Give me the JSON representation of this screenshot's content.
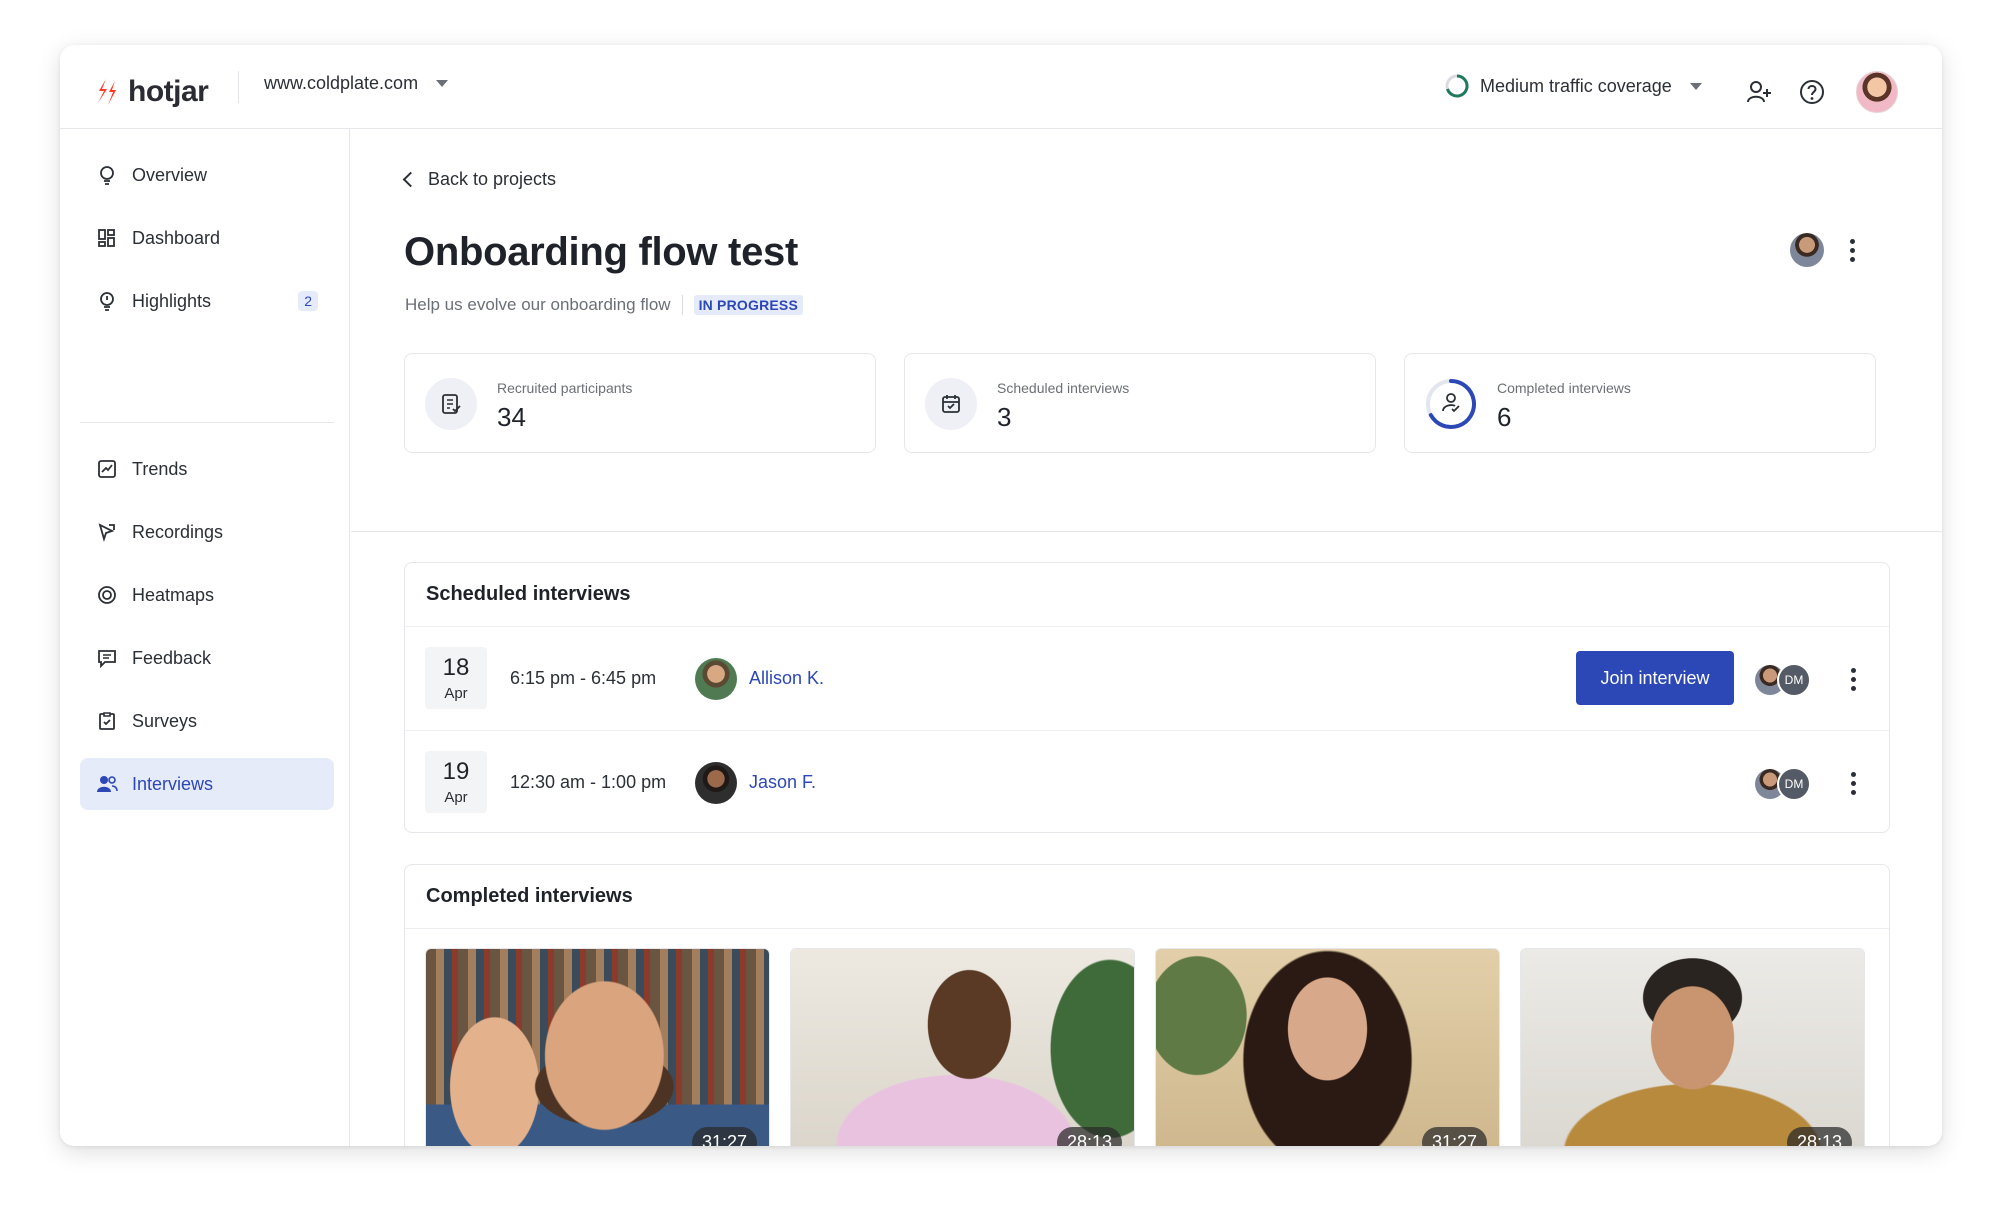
{
  "header": {
    "logo_text": "hotjar",
    "site": "www.coldplate.com",
    "traffic_label": "Medium traffic coverage",
    "brand_color": "#fd3a25",
    "accent_color": "#2c47b6"
  },
  "sidebar": {
    "items": [
      {
        "label": "Overview",
        "icon": "lightbulb-icon"
      },
      {
        "label": "Dashboard",
        "icon": "dashboard-icon"
      },
      {
        "label": "Highlights",
        "icon": "highlight-icon",
        "badge": "2"
      },
      {
        "label": "Trends",
        "icon": "trends-icon"
      },
      {
        "label": "Recordings",
        "icon": "recordings-icon"
      },
      {
        "label": "Heatmaps",
        "icon": "heatmaps-icon"
      },
      {
        "label": "Feedback",
        "icon": "feedback-icon"
      },
      {
        "label": "Surveys",
        "icon": "surveys-icon"
      },
      {
        "label": "Interviews",
        "icon": "interviews-icon",
        "active": true
      }
    ]
  },
  "project": {
    "back_label": "Back to projects",
    "title": "Onboarding flow test",
    "description": "Help us evolve our onboarding flow",
    "status": "IN PROGRESS"
  },
  "stats": [
    {
      "label": "Recruited participants",
      "value": "34",
      "icon": "document-check-icon"
    },
    {
      "label": "Scheduled interviews",
      "value": "3",
      "icon": "calendar-check-icon"
    },
    {
      "label": "Completed interviews",
      "value": "6",
      "icon": "person-check-icon",
      "progress": 0.67
    }
  ],
  "scheduled": {
    "title": "Scheduled interviews",
    "rows": [
      {
        "day": "18",
        "month": "Apr",
        "time": "6:15 pm - 6:45 pm",
        "name": "Allison K.",
        "action": "Join interview",
        "initials": "DM"
      },
      {
        "day": "19",
        "month": "Apr",
        "time": "12:30 am - 1:00 pm",
        "name": "Jason F.",
        "initials": "DM"
      }
    ]
  },
  "completed": {
    "title": "Completed interviews",
    "videos": [
      {
        "duration": "31:27"
      },
      {
        "duration": "28:13"
      },
      {
        "duration": "31:27"
      },
      {
        "duration": "28:13"
      }
    ]
  }
}
